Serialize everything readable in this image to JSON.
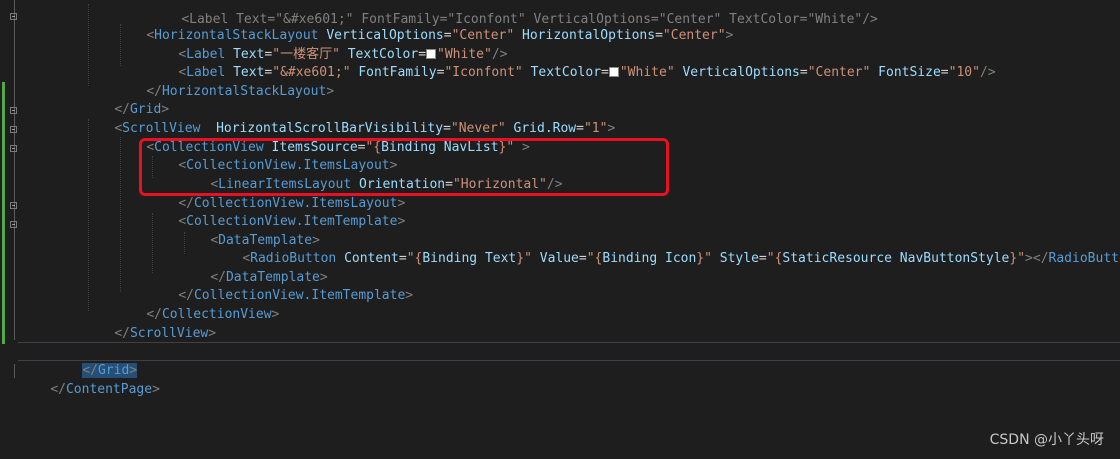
{
  "lines": {
    "l0": {
      "text": "<Label Text=\"&#xe601;\" FontFamily=\"Iconfont\" VerticalOptions=\"Center\" TextColor=\"White\"/>"
    },
    "l1": {
      "open": "<",
      "el": "HorizontalStackLayout",
      "a1": "VerticalOptions",
      "v1": "\"Center\"",
      "a2": "HorizontalOptions",
      "v2": "\"Center\"",
      "close": ">"
    },
    "l2": {
      "open": "<",
      "el": "Label",
      "a1": "Text",
      "v1": "\"一楼客厅\"",
      "a2": "TextColor",
      "v2": "\"White\"",
      "close": "/>"
    },
    "l3": {
      "open": "<",
      "el": "Label",
      "a1": "Text",
      "v1": "\"&#xe601;\"",
      "a2": "FontFamily",
      "v2": "\"Iconfont\"",
      "a3": "TextColor",
      "v3": "\"White\"",
      "a4": "VerticalOptions",
      "v4": "\"Center\"",
      "a5": "FontSize",
      "v5": "\"10\"",
      "close": "/>"
    },
    "l4": {
      "open": "</",
      "el": "HorizontalStackLayout",
      "close": ">"
    },
    "l5": {
      "open": "</",
      "el": "Grid",
      "close": ">"
    },
    "l6": {
      "open": "<",
      "el": "ScrollView",
      "a1": "HorizontalScrollBarVisibility",
      "v1": "\"Never\"",
      "a2": "Grid.Row",
      "v2": "\"1\"",
      "close": ">"
    },
    "l7": {
      "open": "<",
      "el": "CollectionView",
      "a1": "ItemsSource",
      "v1a": "\"{",
      "v1b": "Binding NavList",
      "v1c": "}\"",
      "close": " >"
    },
    "l8": {
      "open": "<",
      "el": "CollectionView.ItemsLayout",
      "close": ">"
    },
    "l9": {
      "open": "<",
      "el": "LinearItemsLayout",
      "a1": "Orientation",
      "v1": "\"Horizontal\"",
      "close": "/>"
    },
    "l10": {
      "open": "</",
      "el": "CollectionView.ItemsLayout",
      "close": ">"
    },
    "l11": {
      "open": "<",
      "el": "CollectionView.ItemTemplate",
      "close": ">"
    },
    "l12": {
      "open": "<",
      "el": "DataTemplate",
      "close": ">"
    },
    "l13": {
      "open": "<",
      "el": "RadioButton",
      "a1": "Content",
      "v1a": "\"{",
      "v1b": "Binding Text",
      "v1c": "}\"",
      "a2": "Value",
      "v2a": "\"{",
      "v2b": "Binding Icon",
      "v2c": "}\"",
      "a3": "Style",
      "v3a": "\"{",
      "v3b": "StaticResource NavButtonStyle",
      "v3c": "}\"",
      "close": "></",
      "el2": "RadioButto"
    },
    "l14": {
      "open": "</",
      "el": "DataTemplate",
      "close": ">"
    },
    "l15": {
      "open": "</",
      "el": "CollectionView.ItemTemplate",
      "close": ">"
    },
    "l16": {
      "open": "</",
      "el": "CollectionView",
      "close": ">"
    },
    "l17": {
      "open": "</",
      "el": "ScrollView",
      "close": ">"
    },
    "l19": {
      "open": "</",
      "el": "Grid",
      "close": ">"
    },
    "l20": {
      "open": "</",
      "el": "ContentPage",
      "close": ">"
    }
  },
  "watermark": "CSDN @小丫头呀",
  "colors": {
    "background": "#1e1e1e",
    "tag_bracket": "#808080",
    "element": "#569cd6",
    "attribute": "#9cdcfe",
    "string": "#ce9178",
    "highlight_box": "#e81123",
    "change_bar": "#57a64a",
    "selection": "#264f78"
  },
  "icons": {
    "fold_markers": "collapse-icon",
    "color_swatch": "white-color-swatch-icon"
  }
}
